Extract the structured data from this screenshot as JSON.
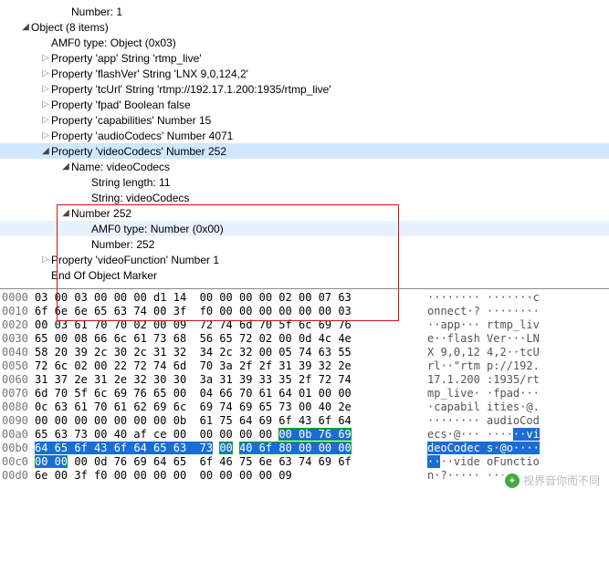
{
  "tree": {
    "r0": "Number: 1",
    "r1": "Object (8 items)",
    "r2": "AMF0 type: Object (0x03)",
    "r3": "Property 'app' String 'rtmp_live'",
    "r4": "Property 'flashVer' String 'LNX 9,0,124,2'",
    "r5": "Property 'tcUrl' String 'rtmp://192.17.1.200:1935/rtmp_live'",
    "r6": "Property 'fpad' Boolean false",
    "r7": "Property 'capabilities' Number 15",
    "r8": "Property 'audioCodecs' Number 4071",
    "r9": "Property 'videoCodecs' Number 252",
    "r10": "Name: videoCodecs",
    "r11": "String length: 11",
    "r12": "String: videoCodecs",
    "r13": "Number 252",
    "r14": "AMF0 type: Number (0x00)",
    "r15": "Number: 252",
    "r16": "Property 'videoFunction' Number 1",
    "r17": "End Of Object Marker"
  },
  "hex": [
    {
      "o": "0000",
      "b": "03 00 03 00 00 00 d1 14  00 00 00 00 02 00 07 63",
      "a": "········ ·······c"
    },
    {
      "o": "0010",
      "b": "6f 6e 6e 65 63 74 00 3f  f0 00 00 00 00 00 00 03",
      "a": "onnect·? ········"
    },
    {
      "o": "0020",
      "b": "00 03 61 70 70 02 00 09  72 74 6d 70 5f 6c 69 76",
      "a": "··app··· rtmp_liv"
    },
    {
      "o": "0030",
      "b": "65 00 08 66 6c 61 73 68  56 65 72 02 00 0d 4c 4e",
      "a": "e··flash Ver···LN"
    },
    {
      "o": "0040",
      "b": "58 20 39 2c 30 2c 31 32  34 2c 32 00 05 74 63 55",
      "a": "X 9,0,12 4,2··tcU"
    },
    {
      "o": "0050",
      "b": "72 6c 02 00 22 72 74 6d  70 3a 2f 2f 31 39 32 2e",
      "a": "rl··\"rtm p://192."
    },
    {
      "o": "0060",
      "b": "31 37 2e 31 2e 32 30 30  3a 31 39 33 35 2f 72 74",
      "a": "17.1.200 :1935/rt"
    },
    {
      "o": "0070",
      "b": "6d 70 5f 6c 69 76 65 00  04 66 70 61 64 01 00 00",
      "a": "mp_live· ·fpad···"
    },
    {
      "o": "0080",
      "b": "0c 63 61 70 61 62 69 6c  69 74 69 65 73 00 40 2e",
      "a": "·capabil ities·@."
    },
    {
      "o": "0090",
      "b": "00 00 00 00 00 00 00 0b  61 75 64 69 6f 43 6f 64",
      "a": "········ audioCod"
    }
  ],
  "hexA": {
    "o": "00a0",
    "pre": "65 63 73 00 40 af ce 00  00 00 00 00 ",
    "hl": "00 0b 76 69",
    "apre": "ecs·@··· ····",
    "ahl": "··vi"
  },
  "hexB": {
    "o": "00b0",
    "hl1": "64 65 6f 43 6f 64 65 63  73",
    "mid": " ",
    "hl2": "00",
    "sp": " ",
    "hl3": "40 6f 80 00 00 00",
    "a1": "deoCodec s",
    "a2": "·@o····"
  },
  "hexC": {
    "o": "00c0",
    "hl": "00 00",
    "mid": " 00 0d 76 69 64 65  6f 46 75 6e 63 74 69 6f",
    "a1": "··",
    "a2": "··vide oFunctio"
  },
  "hexD": {
    "o": "00d0",
    "b": "6e 00 3f f0 00 00 00 00  00 00 00 00 09        ",
    "a": "n·?····· ·····"
  },
  "wm": "视界音你而不同"
}
